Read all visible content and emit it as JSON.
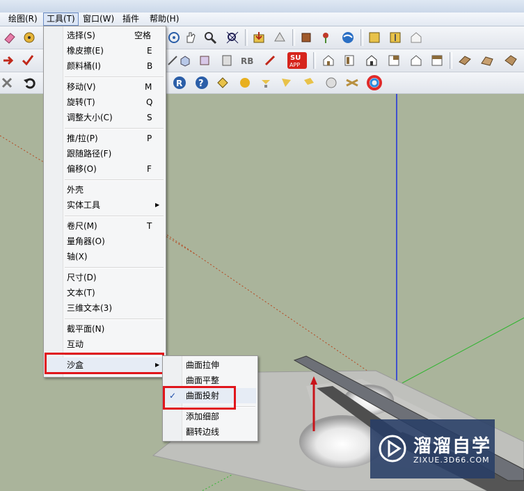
{
  "menubar": {
    "items": [
      "绘图(R)",
      "工具(T)",
      "窗口(W)",
      "插件",
      "帮助(H)"
    ]
  },
  "toolbar3": {
    "r_label": "R",
    "help_label": "?"
  },
  "tools_menu": {
    "groups": [
      [
        {
          "label": "选择(S)",
          "key": "空格"
        },
        {
          "label": "橡皮擦(E)",
          "key": "E"
        },
        {
          "label": "颜料桶(I)",
          "key": "B"
        }
      ],
      [
        {
          "label": "移动(V)",
          "key": "M"
        },
        {
          "label": "旋转(T)",
          "key": "Q"
        },
        {
          "label": "调整大小(C)",
          "key": "S"
        }
      ],
      [
        {
          "label": "推/拉(P)",
          "key": "P"
        },
        {
          "label": "跟随路径(F)",
          "key": ""
        },
        {
          "label": "偏移(O)",
          "key": "F"
        }
      ],
      [
        {
          "label": "外壳",
          "key": ""
        },
        {
          "label": "实体工具",
          "key": "",
          "submenu": true
        }
      ],
      [
        {
          "label": "卷尺(M)",
          "key": "T"
        },
        {
          "label": "量角器(O)",
          "key": ""
        },
        {
          "label": "轴(X)",
          "key": ""
        }
      ],
      [
        {
          "label": "尺寸(D)",
          "key": ""
        },
        {
          "label": "文本(T)",
          "key": ""
        },
        {
          "label": "三维文本(3)",
          "key": ""
        }
      ],
      [
        {
          "label": "截平面(N)",
          "key": ""
        },
        {
          "label": "互动",
          "key": ""
        }
      ],
      [
        {
          "label": "沙盒",
          "key": "",
          "submenu": true
        }
      ]
    ]
  },
  "sandbox_submenu": {
    "items": [
      {
        "label": "曲面拉伸",
        "checked": false
      },
      {
        "label": "曲面平整",
        "checked": false
      },
      {
        "label": "曲面投射",
        "checked": true
      },
      {
        "label": "添加细部",
        "checked": false
      },
      {
        "label": "翻转边线",
        "checked": false
      }
    ],
    "check_mark": "✓"
  },
  "watermark": {
    "title": "溜溜自学",
    "url": "ZIXUE.3D66.COM"
  },
  "colors": {
    "highlight": "#e0151b",
    "arrow": "#c8141a",
    "axis_blue": "#1d2fe0",
    "axis_green": "#2fb52f",
    "axis_red": "#b5461e"
  }
}
